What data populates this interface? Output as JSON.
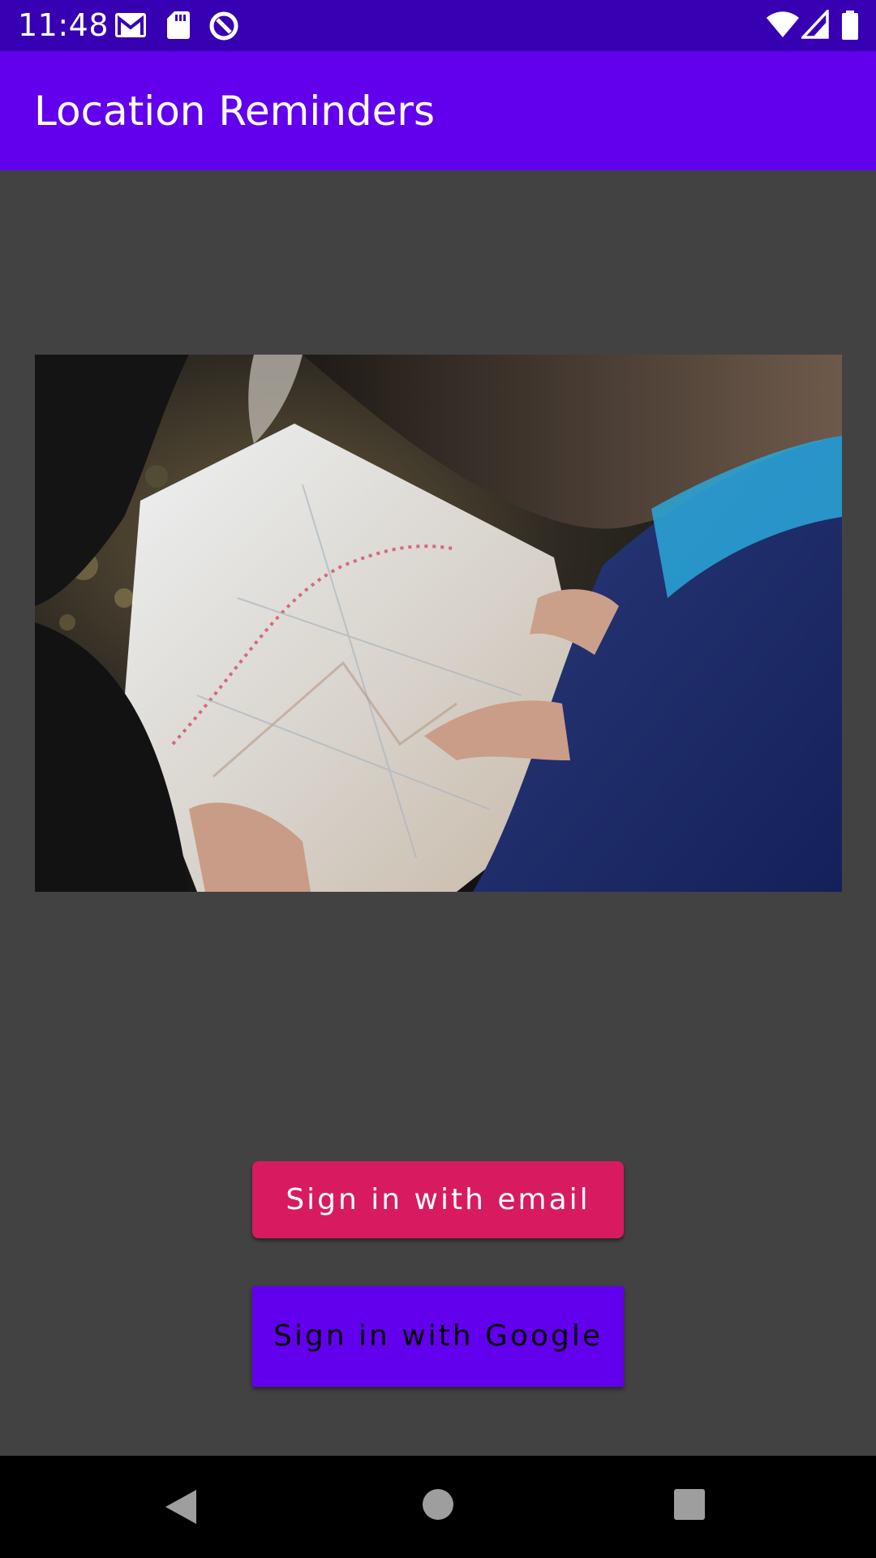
{
  "status_bar": {
    "time": "11:48",
    "left_icons": [
      "gmail-icon",
      "sd-card-icon",
      "data-saver-icon"
    ],
    "right_icons": [
      "wifi-icon",
      "cell-signal-icon",
      "battery-icon"
    ]
  },
  "app_bar": {
    "title": "Location Reminders",
    "color": "#6200EE"
  },
  "hero": {
    "image": "people-reading-map-photo"
  },
  "buttons": {
    "email_label": "Sign in with email",
    "google_label": "Sign in with Google"
  },
  "colors": {
    "status_bar": "#3700B3",
    "background": "#424242",
    "email_button": "#D81B60",
    "google_button": "#6200EE"
  },
  "nav_bar": {
    "icons": [
      "back-icon",
      "home-icon",
      "recents-icon"
    ]
  }
}
